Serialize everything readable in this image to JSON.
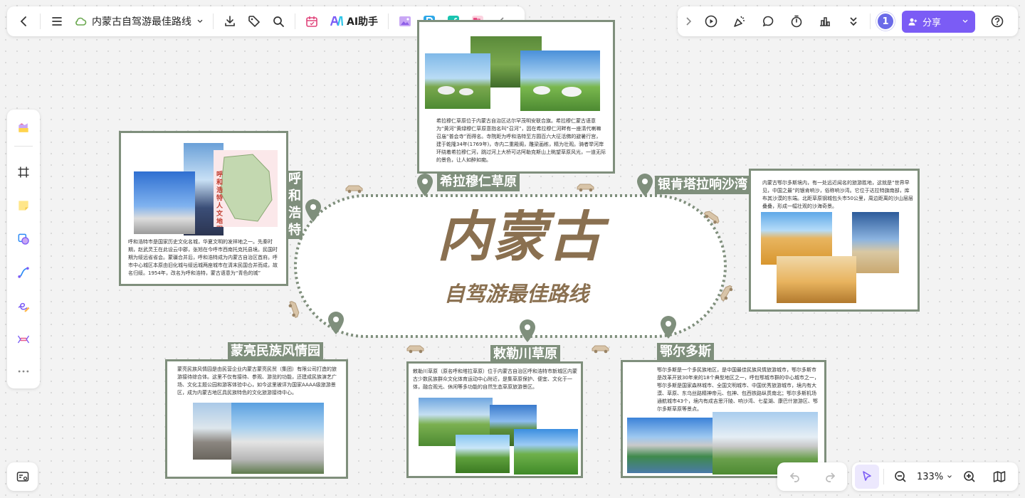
{
  "doc": {
    "title": "内蒙古自驾游最佳路线",
    "ai_label": "AI助手",
    "share_label": "分享",
    "avatar_text": "1",
    "zoom": "133%"
  },
  "colors": {
    "accent": "#7b5cf5",
    "frame": "#7f8f7c",
    "title_brown": "#8a7050"
  },
  "center": {
    "title": "内蒙古",
    "subtitle": "自驾游最佳路线"
  },
  "labels": {
    "xilamuren": "希拉穆仁草原",
    "huhehaote": "呼和浩特",
    "xiangshawan": "银肯塔拉响沙湾",
    "menghan": "蒙亮民族风情园",
    "chilechuan": "敕勒川草原",
    "eerduosi": "鄂尔多斯"
  },
  "cards": {
    "xilamuren_text": "希拉穆仁草原位于内蒙古自治区达尔罕茂明安联合旗。希拉穆仁蒙古语意为“黄河”黄绿穆仁草原意指名叫“召河”，因在希拉穆仁河畔有一座清代喇嘛召庙“普会寺”而得名。寺院距为呼和浩特至方圆百六大征活佛的避暑行宫，建于乾隆34年(1769年)，寺内二重殿阁，雕梁画栋，精为壮观。骑者举河岸环绕着希拉穆仁河，跳过河上大桥可达阿勒克斯山上眺望草原风光，一道无际的景色，让人如醉如痴。",
    "huhehaote_text": "呼和浩特市是国家历史文化名城，华夏文明的发祥地之一。先秦时期，赵武灵王在此设云中郡，张旭在今呼市西南托克托县境。民国时期为绥远省省会。蒙疆合并后，呼和浩特成为内蒙古自治区首府。呼市中心城区本原由旧化城与绥远城两座城市在清末民国合并而成，故名归绥。1954年，改名为呼和浩特，蒙古语意为“青色的城”",
    "huhehaote_map_label": "呼和浩特人文地图",
    "xiangshawan_text": "内蒙古鄂尔多斯境内，有一处远近闻名的旅游胜地，这就是“世界早见，中国之最”的银肯响沙，俗称响沙湾。它位于达拉特旗南部，库布其沙漠的东端。北距草原钢城包头市50公里，周边距离的沙山层层叠叠，形成一幅壮观的沙海奇景。",
    "menghan_text": "蒙亮民族风情园是由民营企业内蒙古蒙亮民贸（集团）有限公司打造的旅游接待综合体。这里不仅有接待、参观、游览的功能，还建成民族演艺广场、文化主题公园和游客体验中心，如今这里被评为国家AAAA级旅游景区，成为内蒙古地区具民族特色的文化旅游接待中心。",
    "chilechuan_text": "敕勒川草原（原名呼和塔拉草原）位于内蒙古自治区呼和浩特市新城区内蒙古少数民族群众文化体育运动中心附近，是集草原保护、便宜、文化于一体，融合观光、休闲等多功能的自然生态草原旅游景区。",
    "eerduosi_text": "鄂尔多斯是一个多民族地区，是中国最佳民族风情旅游城市，鄂尔多斯市是改革开放30年来的18个典型地区之一，呼包鄂城市群的中心城市之一，鄂尔多斯是国家森林城市、全国文明城市、中国优秀旅游城市，境内有大漠、草原、东乌丝路精神帝元、包神、包西铁路纵贯南北；鄂尔多斯机场通航城市43个，境内有成吉思汗陵、响沙湾、七星湖、康巴什旅游区、鄂尔多斯草原等景点。"
  },
  "icons": [
    "back-arrow-icon",
    "menu-icon",
    "cloud-icon",
    "download-icon",
    "tag-icon",
    "search-icon",
    "calendar-icon",
    "ai-logo-icon",
    "play-icon",
    "celebrate-icon",
    "comment-icon",
    "timer-icon",
    "chart-icon",
    "chevron-double-down-icon",
    "user-plus-icon",
    "help-icon"
  ]
}
